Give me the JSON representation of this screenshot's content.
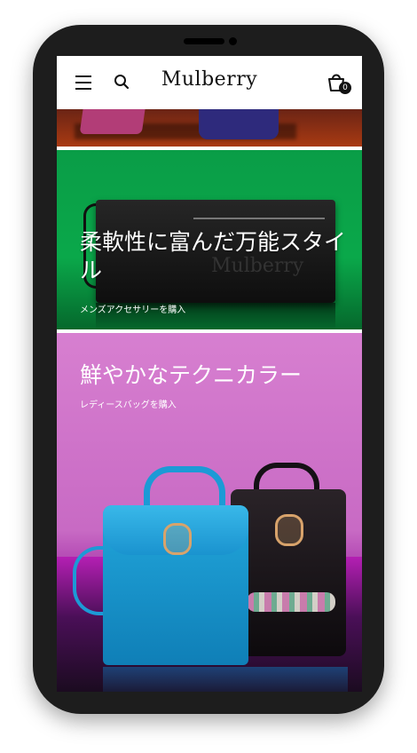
{
  "header": {
    "logo": "Mulberry",
    "bag_count": "0"
  },
  "hero_green": {
    "title": "柔軟性に富んだ万能スタイル",
    "cta": "メンズアクセサリーを購入",
    "clutch_brand": "Mulberry"
  },
  "hero_pink": {
    "title": "鮮やかなテクニカラー",
    "cta": "レディースバッグを購入"
  },
  "colors": {
    "green": "#0aa84a",
    "pink": "#d77fd0",
    "magenta": "#b41fb3",
    "blue_bag": "#22a7dc"
  },
  "icons": [
    "menu-icon",
    "search-icon",
    "shopping-bag-icon"
  ]
}
